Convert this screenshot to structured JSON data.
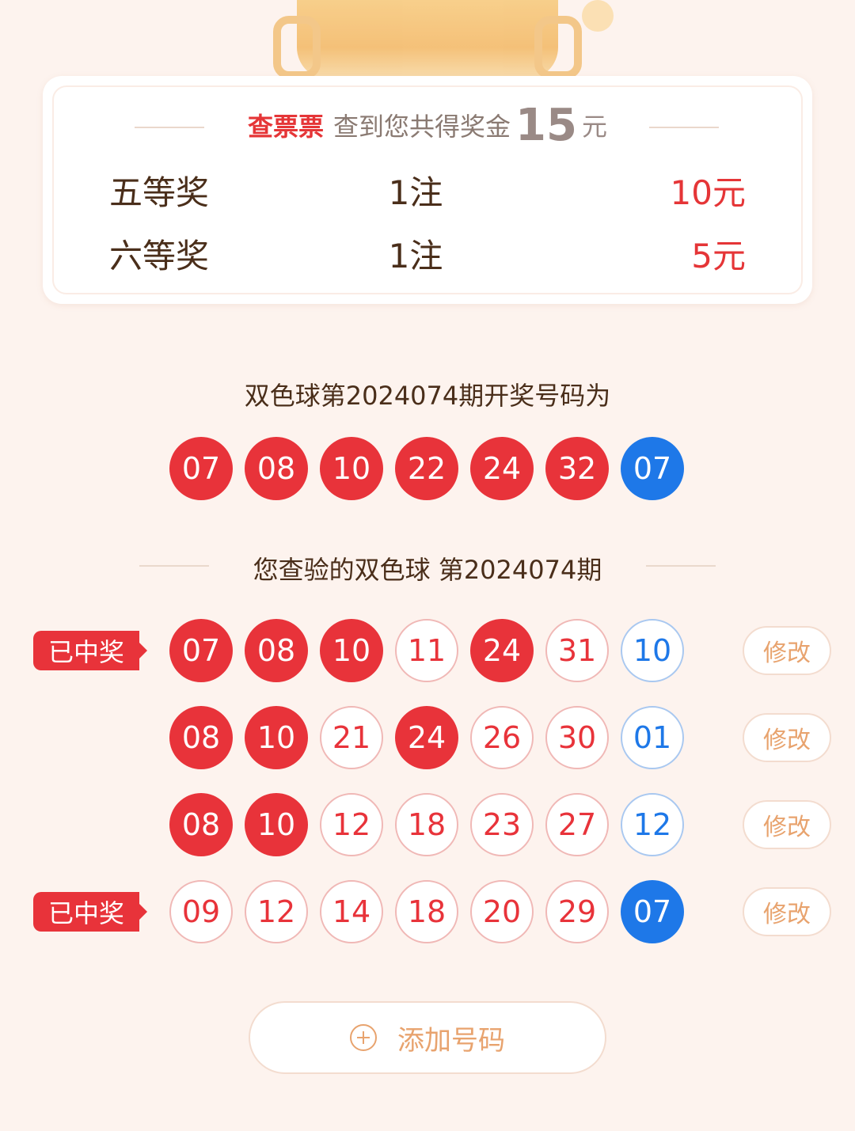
{
  "summary": {
    "brand": "查票票",
    "text": "查到您共得奖金",
    "amount": "15",
    "unit": "元",
    "prizes": [
      {
        "name": "五等奖",
        "count": "1注",
        "amount": "10元"
      },
      {
        "name": "六等奖",
        "count": "1注",
        "amount": "5元"
      }
    ]
  },
  "draw": {
    "title": "双色球第2024074期开奖号码为",
    "red": [
      "07",
      "08",
      "10",
      "22",
      "24",
      "32"
    ],
    "blue": "07"
  },
  "check": {
    "title": "您查验的双色球 第2024074期",
    "badge_label": "已中奖",
    "edit_label": "修改",
    "tickets": [
      {
        "won": true,
        "reds": [
          {
            "n": "07",
            "hit": true
          },
          {
            "n": "08",
            "hit": true
          },
          {
            "n": "10",
            "hit": true
          },
          {
            "n": "11",
            "hit": false
          },
          {
            "n": "24",
            "hit": true
          },
          {
            "n": "31",
            "hit": false
          }
        ],
        "blue": {
          "n": "10",
          "hit": false
        }
      },
      {
        "won": false,
        "reds": [
          {
            "n": "08",
            "hit": true
          },
          {
            "n": "10",
            "hit": true
          },
          {
            "n": "21",
            "hit": false
          },
          {
            "n": "24",
            "hit": true
          },
          {
            "n": "26",
            "hit": false
          },
          {
            "n": "30",
            "hit": false
          }
        ],
        "blue": {
          "n": "01",
          "hit": false
        }
      },
      {
        "won": false,
        "reds": [
          {
            "n": "08",
            "hit": true
          },
          {
            "n": "10",
            "hit": true
          },
          {
            "n": "12",
            "hit": false
          },
          {
            "n": "18",
            "hit": false
          },
          {
            "n": "23",
            "hit": false
          },
          {
            "n": "27",
            "hit": false
          }
        ],
        "blue": {
          "n": "12",
          "hit": false
        }
      },
      {
        "won": true,
        "reds": [
          {
            "n": "09",
            "hit": false
          },
          {
            "n": "12",
            "hit": false
          },
          {
            "n": "14",
            "hit": false
          },
          {
            "n": "18",
            "hit": false
          },
          {
            "n": "20",
            "hit": false
          },
          {
            "n": "29",
            "hit": false
          }
        ],
        "blue": {
          "n": "07",
          "hit": true
        }
      }
    ],
    "add_label": "添加号码"
  },
  "colors": {
    "red": "#e8333a",
    "blue": "#1e78e8",
    "accent": "#e8a36e"
  }
}
